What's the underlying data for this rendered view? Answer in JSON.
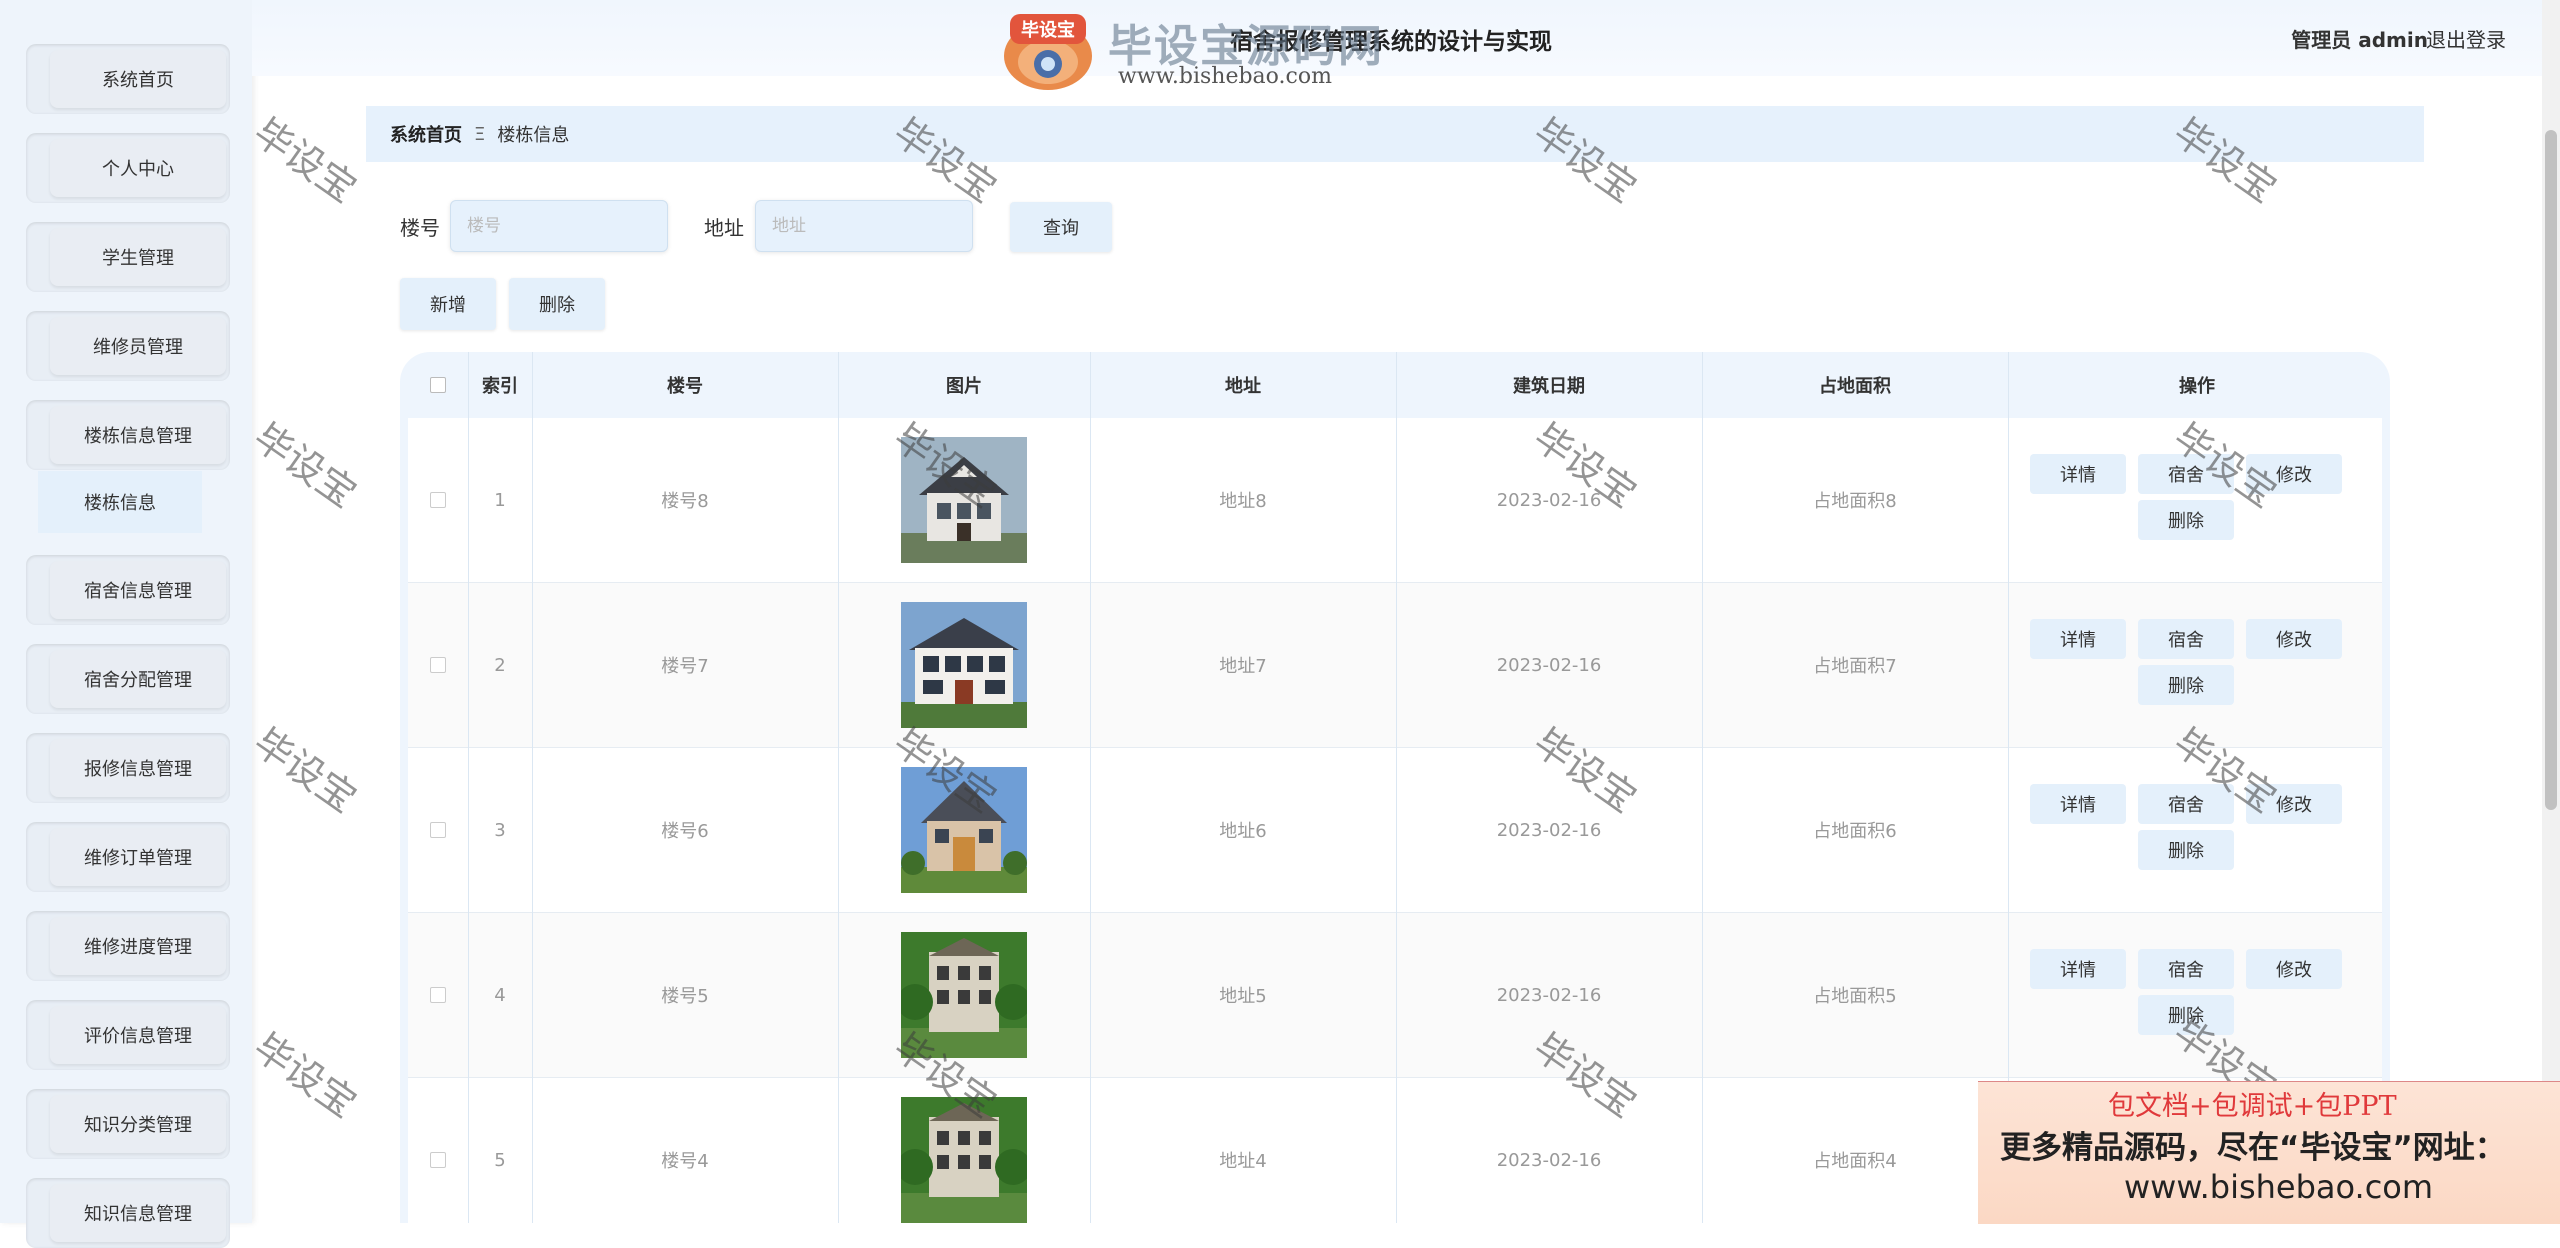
{
  "header": {
    "title": "宿舍报修管理系统的设计与实现",
    "user_label": "管理员 admin",
    "logout_label": "退出登录"
  },
  "watermark": {
    "logo_badge": "毕设宝",
    "logo_text": "毕设宝源码网",
    "logo_url": "www.bishebao.com",
    "tile": "毕设宝"
  },
  "sidebar": {
    "items": [
      {
        "label": "系统首页"
      },
      {
        "label": "个人中心"
      },
      {
        "label": "学生管理"
      },
      {
        "label": "维修员管理"
      },
      {
        "label": "楼栋信息管理"
      },
      {
        "label": "宿舍信息管理"
      },
      {
        "label": "宿舍分配管理"
      },
      {
        "label": "报修信息管理"
      },
      {
        "label": "维修订单管理"
      },
      {
        "label": "维修进度管理"
      },
      {
        "label": "评价信息管理"
      },
      {
        "label": "知识分类管理"
      },
      {
        "label": "知识信息管理"
      }
    ],
    "submenu_label": "楼栋信息"
  },
  "breadcrumb": {
    "home": "系统首页",
    "separator": "Ξ",
    "current": "楼栋信息"
  },
  "search": {
    "building_label": "楼号",
    "building_placeholder": "楼号",
    "address_label": "地址",
    "address_placeholder": "地址",
    "query_label": "查询"
  },
  "actions": {
    "add_label": "新增",
    "delete_label": "删除"
  },
  "table": {
    "columns": [
      "索引",
      "楼号",
      "图片",
      "地址",
      "建筑日期",
      "占地面积",
      "操作"
    ],
    "op_labels": {
      "detail": "详情",
      "dorm": "宿舍",
      "edit": "修改",
      "delete": "删除"
    },
    "rows": [
      {
        "index": "1",
        "building": "楼号8",
        "address": "地址8",
        "date": "2023-02-16",
        "area": "占地面积8"
      },
      {
        "index": "2",
        "building": "楼号7",
        "address": "地址7",
        "date": "2023-02-16",
        "area": "占地面积7"
      },
      {
        "index": "3",
        "building": "楼号6",
        "address": "地址6",
        "date": "2023-02-16",
        "area": "占地面积6"
      },
      {
        "index": "4",
        "building": "楼号5",
        "address": "地址5",
        "date": "2023-02-16",
        "area": "占地面积5"
      },
      {
        "index": "5",
        "building": "楼号4",
        "address": "地址4",
        "date": "2023-02-16",
        "area": "占地面积4"
      }
    ]
  },
  "ad": {
    "line1": "包文档+包调试+包PPT",
    "line2": "更多精品源码，尽在“毕设宝”网址：",
    "line3": "www.bishebao.com"
  },
  "colors": {
    "accent": "#e4f0fb",
    "sidebar_bg": "#eef4fb",
    "ad_red": "#e0393b"
  }
}
